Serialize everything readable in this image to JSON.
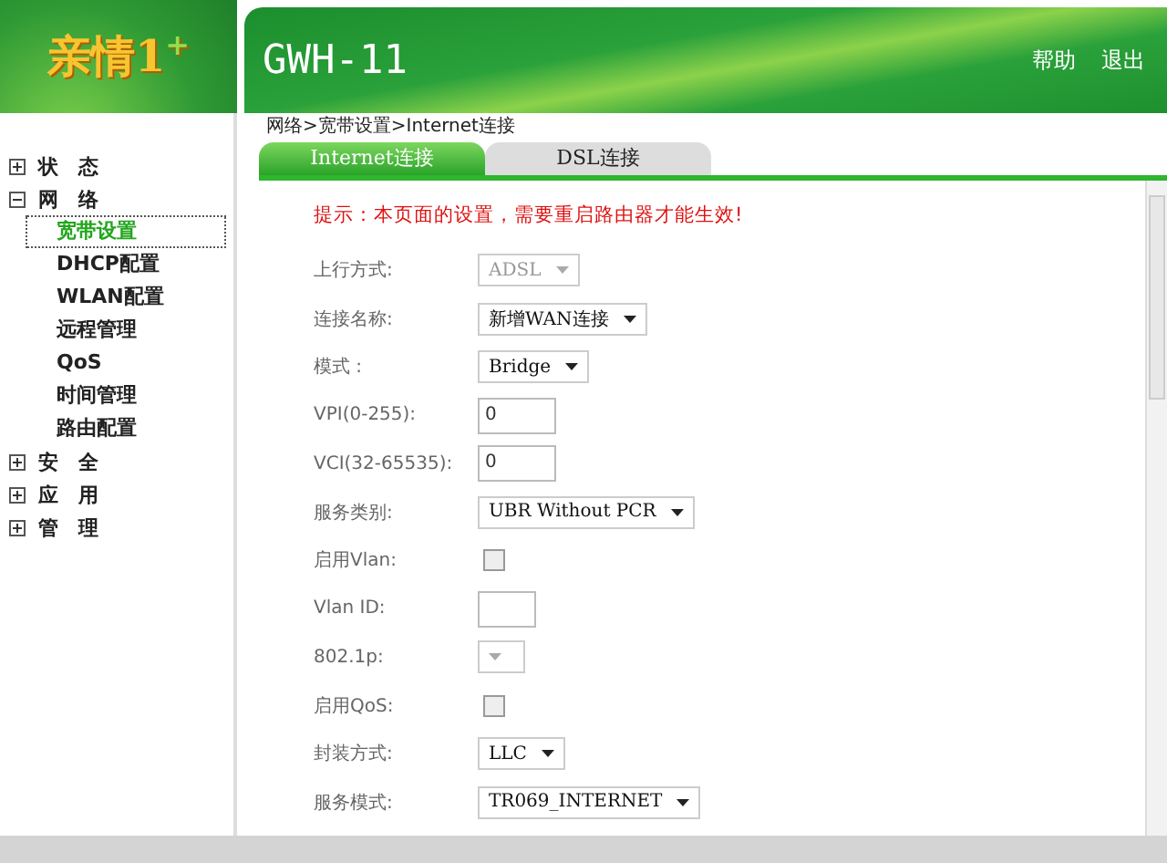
{
  "logo": {
    "text": "亲情1$^{+}$"
  },
  "header": {
    "title": "GWH-11",
    "links": [
      "帮助",
      "退出"
    ]
  },
  "sidebar": {
    "items": [
      {
        "label": "状　态",
        "expanded": false
      },
      {
        "label": "网　络",
        "expanded": true,
        "children": [
          {
            "label": "宽带设置",
            "selected": true
          },
          {
            "label": "DHCP配置",
            "selected": false
          },
          {
            "label": "WLAN配置",
            "selected": false
          },
          {
            "label": "远程管理",
            "selected": false
          },
          {
            "label": "QoS",
            "selected": false
          },
          {
            "label": "时间管理",
            "selected": false
          },
          {
            "label": "路由配置",
            "selected": false
          }
        ]
      },
      {
        "label": "安　全",
        "expanded": false
      },
      {
        "label": "应　用",
        "expanded": false
      },
      {
        "label": "管　理",
        "expanded": false
      }
    ]
  },
  "breadcrumb": "网络>宽带设置>Internet连接",
  "tabs": [
    {
      "label": "Internet连接",
      "selected": true
    },
    {
      "label": "DSL连接",
      "selected": false
    }
  ],
  "notice": "提示：本页面的设置，需要重启路由器才能生效!",
  "form": [
    {
      "label": "上行方式:",
      "kind": "select",
      "value": "ADSL",
      "disabled": true
    },
    {
      "label": "连接名称:",
      "kind": "select",
      "value": "新增WAN连接",
      "disabled": false
    },
    {
      "label": "模式 :",
      "kind": "select",
      "value": "Bridge",
      "disabled": false
    },
    {
      "label": "VPI(0-255):",
      "kind": "input",
      "value": "0"
    },
    {
      "label": "VCI(32-65535):",
      "kind": "input",
      "value": "0"
    },
    {
      "label": "服务类别:",
      "kind": "select",
      "value": "UBR Without PCR",
      "disabled": false
    },
    {
      "label": "启用Vlan:",
      "kind": "checkbox",
      "checked": false
    },
    {
      "label": "Vlan ID:",
      "kind": "input"
    },
    {
      "label": "802.1p:",
      "kind": "select",
      "disabled": true
    },
    {
      "label": "启用QoS:",
      "kind": "checkbox",
      "checked": false
    },
    {
      "label": "封装方式:",
      "kind": "select",
      "value": "LLC",
      "disabled": false
    },
    {
      "label": "服务模式:",
      "kind": "select",
      "value": "TR069_INTERNET",
      "disabled": false
    }
  ]
}
